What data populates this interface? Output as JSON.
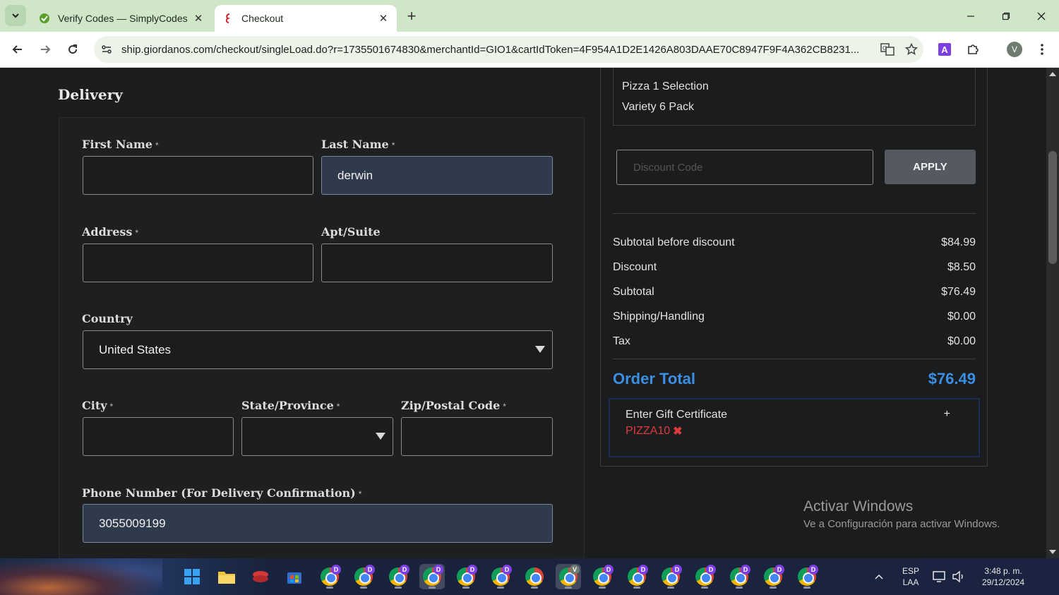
{
  "browser": {
    "tabs": [
      {
        "title": "Verify Codes — SimplyCodes",
        "favicon": "simplycodes-icon",
        "active": false
      },
      {
        "title": "Checkout",
        "favicon": "giordanos-icon",
        "active": true
      }
    ],
    "url": "ship.giordanos.com/checkout/singleLoad.do?r=1735501674830&merchantId=GIO1&cartIdToken=4F954A1D2E1426A803DAAE70C8947F9F4A362CB8231...",
    "profile_initial": "V",
    "extension_initial": "A"
  },
  "form": {
    "section_title": "Delivery",
    "required_mark": "*",
    "first_name": {
      "label": "First Name",
      "value": ""
    },
    "last_name": {
      "label": "Last Name",
      "value": "derwin"
    },
    "address": {
      "label": "Address",
      "value": ""
    },
    "apt": {
      "label": "Apt/Suite",
      "value": ""
    },
    "country": {
      "label": "Country",
      "value": "United States"
    },
    "city": {
      "label": "City",
      "value": ""
    },
    "state": {
      "label": "State/Province",
      "value": ""
    },
    "zip": {
      "label": "Zip/Postal Code",
      "value": ""
    },
    "phone": {
      "label": "Phone Number (For Delivery Confirmation)",
      "value": "3055009199"
    }
  },
  "summary": {
    "items": [
      "Pizza 1 Selection",
      "Variety 6 Pack"
    ],
    "discount_placeholder": "Discount Code",
    "apply_label": "APPLY",
    "rows": [
      {
        "label": "Subtotal before discount",
        "value": "$84.99"
      },
      {
        "label": "Discount",
        "value": "$8.50"
      },
      {
        "label": "Subtotal",
        "value": "$76.49"
      },
      {
        "label": "Shipping/Handling",
        "value": "$0.00"
      },
      {
        "label": "Tax",
        "value": "$0.00"
      }
    ],
    "total_label": "Order Total",
    "total_value": "$76.49",
    "gift_label": "Enter Gift Certificate",
    "gift_toggle": "+",
    "gift_code": "PIZZA10",
    "gift_remove": "✖"
  },
  "watermark": {
    "title": "Activar Windows",
    "subtitle": "Ve a Configuración para activar Windows."
  },
  "taskbar": {
    "chrome_badges": [
      "D",
      "D",
      "D",
      "D",
      "D",
      "D",
      "",
      "V",
      "D",
      "D",
      "D",
      "D",
      "D",
      "D",
      "D"
    ],
    "lang_top": "ESP",
    "lang_bottom": "LAA",
    "time": "3:48 p. m.",
    "date": "29/12/2024",
    "colors": {
      "accent": "#3b8fe3",
      "error": "#e03a3e"
    }
  }
}
